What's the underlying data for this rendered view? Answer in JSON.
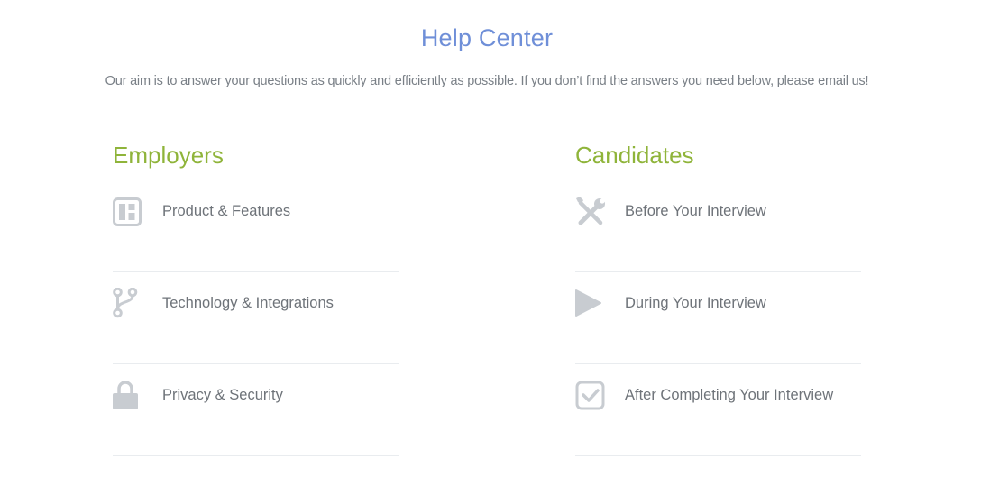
{
  "header": {
    "title": "Help Center",
    "subtitle": "Our aim is to answer your questions as quickly and efficiently as possible. If you don’t find the answers you need below, please email us!"
  },
  "colors": {
    "title": "#6f8fd8",
    "section_heading": "#8fb43a",
    "text": "#6e7379",
    "icon": "#c8ccd1",
    "divider": "#e9ecef"
  },
  "employers": {
    "title": "Employers",
    "items": [
      {
        "label": "Product & Features",
        "icon": "dashboard-icon"
      },
      {
        "label": "Technology & Integrations",
        "icon": "code-fork-icon"
      },
      {
        "label": "Privacy & Security",
        "icon": "lock-icon"
      }
    ]
  },
  "candidates": {
    "title": "Candidates",
    "items": [
      {
        "label": "Before Your Interview",
        "icon": "wrench-screwdriver-icon"
      },
      {
        "label": "During Your Interview",
        "icon": "play-icon"
      },
      {
        "label": "After Completing Your Interview",
        "icon": "checkbox-icon"
      }
    ]
  }
}
